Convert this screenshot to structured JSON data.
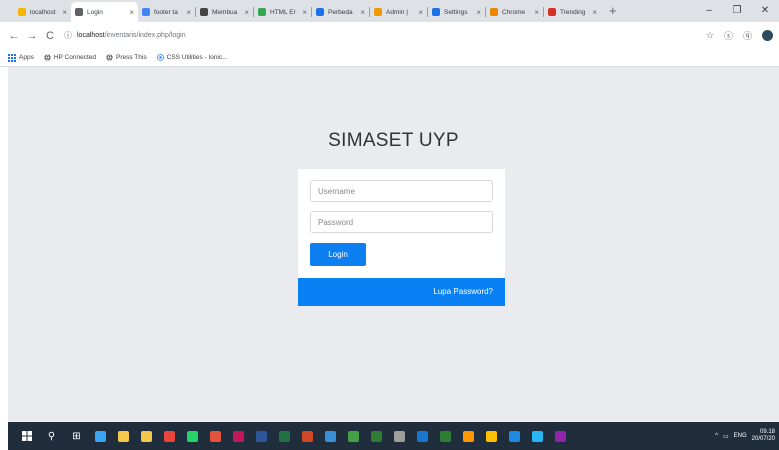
{
  "browser": {
    "tabs": [
      {
        "title": "localhost",
        "color": "#f4b400"
      },
      {
        "title": "Login",
        "color": "#5f6368",
        "active": true
      },
      {
        "title": "footer ta",
        "color": "#4285f4"
      },
      {
        "title": "Membua",
        "color": "#444"
      },
      {
        "title": "HTML Er",
        "color": "#34a853"
      },
      {
        "title": "Perbeda",
        "color": "#1a73e8"
      },
      {
        "title": "Admin |",
        "color": "#f29900"
      },
      {
        "title": "Settings",
        "color": "#1a73e8"
      },
      {
        "title": "Chrome",
        "color": "#ea8600"
      },
      {
        "title": "Trending",
        "color": "#d93025"
      }
    ],
    "new_tab": "+",
    "window_controls": [
      "–",
      "❐",
      "✕"
    ],
    "nav": {
      "back": "←",
      "forward": "→",
      "reload": "C"
    },
    "address": {
      "info_icon": "ⓘ",
      "host": "localhost",
      "path": "/inventaris/index.php/login"
    },
    "toolbar_right": {
      "star": "☆",
      "ext1": "ⓢ",
      "ext2": "ⓠ"
    }
  },
  "bookmarks": [
    {
      "label": "Apps",
      "icon": "apps-grid-icon"
    },
    {
      "label": "HP Connected",
      "icon": "globe-icon"
    },
    {
      "label": "Press This",
      "icon": "globe-icon"
    },
    {
      "label": "CSS Utilities - Ionic...",
      "icon": "ionic-icon"
    }
  ],
  "login": {
    "brand": "SIMASET UYP",
    "username_placeholder": "Username",
    "password_placeholder": "Password",
    "login_button": "Login",
    "forgot_password": "Lupa Password?"
  },
  "colors": {
    "primary": "#0d7ff0",
    "page_bg": "#e9ebee",
    "taskbar": "#1f2d3d"
  },
  "taskbar": {
    "icons": [
      "windows-icon",
      "search-icon",
      "task-view-icon",
      "edge-icon",
      "store-icon",
      "file-explorer-icon",
      "chrome-icon",
      "whatsapp-icon",
      "app-icon",
      "app-icon",
      "word-icon",
      "excel-icon",
      "powerpoint-icon",
      "app-icon",
      "app-icon",
      "app-icon",
      "app-icon",
      "app-icon",
      "app-icon",
      "app-icon",
      "app-icon",
      "app-icon",
      "app-icon",
      "app-icon"
    ],
    "tray_lang": "ENG",
    "time": "09.18",
    "date": "20/07/20"
  }
}
